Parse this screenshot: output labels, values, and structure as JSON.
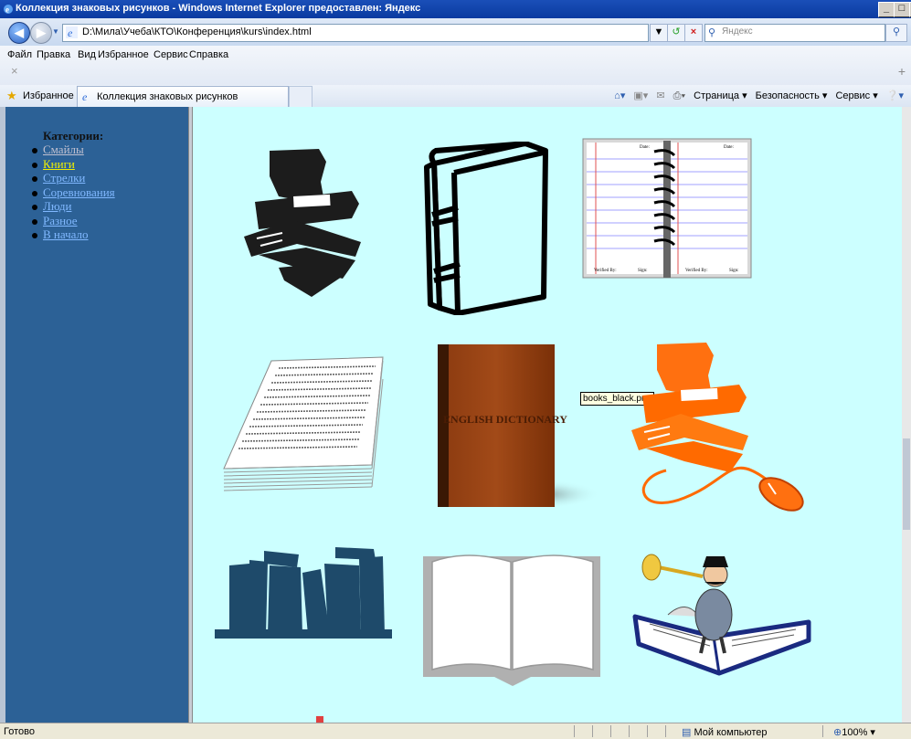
{
  "window": {
    "title": "Коллекция знаковых рисунков - Windows Internet Explorer предоставлен: Яндекс",
    "controls": [
      "_",
      "□",
      "×"
    ]
  },
  "address": {
    "url": "D:\\Мила\\Учеба\\КТО\\Конференция\\kurs\\index.html",
    "search_placeholder": "Яндекс"
  },
  "menu": [
    "Файл",
    "Правка",
    "Вид",
    "Избранное",
    "Сервис",
    "Справка"
  ],
  "favorites": {
    "label": "Избранное",
    "tab_title": "Коллекция знаковых рисунков",
    "commands": [
      "Страница ▾",
      "Безопасность ▾",
      "Сервис ▾"
    ]
  },
  "sidebar": {
    "heading": "Категории:",
    "items": [
      {
        "label": "Смайлы",
        "state": "visited"
      },
      {
        "label": "Книги",
        "state": "active"
      },
      {
        "label": "Стрелки",
        "state": "link"
      },
      {
        "label": "Соревнования",
        "state": "link"
      },
      {
        "label": "Люди",
        "state": "link"
      },
      {
        "label": "Разное",
        "state": "link"
      },
      {
        "label": "В начало",
        "state": "link"
      }
    ]
  },
  "gallery": {
    "tooltip": "books_black.png",
    "images": [
      {
        "name": "books-black-stack-image"
      },
      {
        "name": "book-outline-image"
      },
      {
        "name": "spiral-notebook-image",
        "labels": [
          "Date:",
          "Date:",
          "Verified By:",
          "Sign:",
          "Verified By:",
          "Sign:"
        ]
      },
      {
        "name": "paper-stack-image"
      },
      {
        "name": "english-dictionary-image",
        "text": "ENGLISH DICTIONARY"
      },
      {
        "name": "books-mouse-orange-image"
      },
      {
        "name": "bookshelf-silhouette-image"
      },
      {
        "name": "open-book-gray-image"
      },
      {
        "name": "trumpeter-on-book-image"
      }
    ]
  },
  "status": {
    "text": "Готово",
    "zone": "Мой компьютер",
    "zoom": "100%"
  },
  "colors": {
    "sidebar_bg": "#2c6196",
    "main_bg": "#ccffff",
    "active_link": "#f0f000",
    "link": "#80b8ff"
  }
}
